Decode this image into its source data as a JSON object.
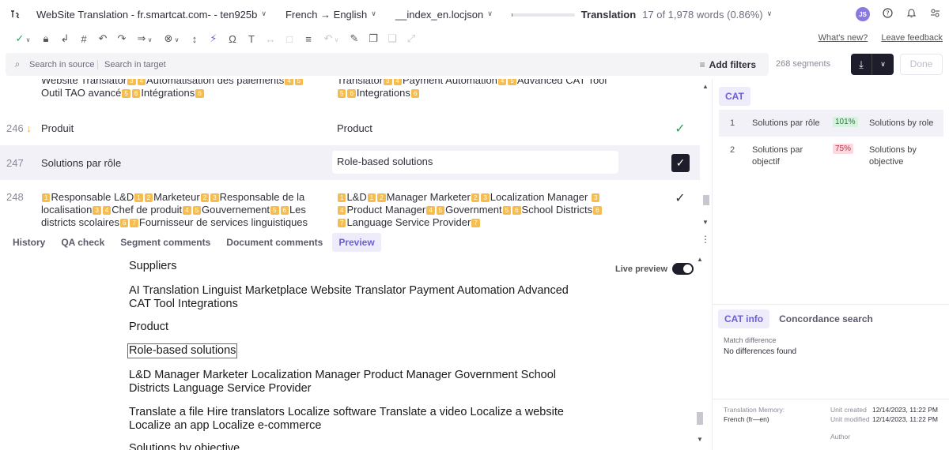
{
  "topbar": {
    "project": "WebSite Translation - fr.smartcat.com- - ten925b",
    "languages": "French → English",
    "file": "__index_en.locjson",
    "stage": "Translation",
    "progress_words": "17 of 1,978 words (0.86%)",
    "progress_fraction": 0.0086,
    "user_initials": "JS"
  },
  "toolbar": {
    "whats_new": "What's new?",
    "leave_feedback": "Leave feedback"
  },
  "search": {
    "source_placeholder": "Search in source",
    "target_placeholder": "Search in target",
    "add_filters": "Add filters",
    "segment_count": "268 segments",
    "done_label": "Done"
  },
  "segments": [
    {
      "num": "",
      "src": [
        {
          "t": "Website Translator"
        },
        {
          "g": "3"
        },
        {
          "g": "4"
        },
        {
          "t": "Automatisation des paiements"
        },
        {
          "g": "4"
        },
        {
          "g": "5"
        },
        {
          "t": " Outil TAO avancé"
        },
        {
          "g": "5"
        },
        {
          "g": "6"
        },
        {
          "t": "Intégrations"
        },
        {
          "g": "6"
        }
      ],
      "tgt": [
        {
          "t": "Translator"
        },
        {
          "g": "3"
        },
        {
          "g": "4"
        },
        {
          "t": "Payment Automation"
        },
        {
          "g": "4"
        },
        {
          "g": "5"
        },
        {
          "t": "Advanced CAT Tool"
        },
        {
          "g": "5"
        },
        {
          "g": "6"
        },
        {
          "t": "Integrations"
        },
        {
          "g": "6"
        }
      ]
    },
    {
      "num": "246",
      "src_text": "Produit",
      "tgt_text": "Product"
    },
    {
      "num": "247",
      "src_text": "Solutions par rôle",
      "tgt_text": "Role-based solutions"
    },
    {
      "num": "248",
      "src": [
        {
          "g": "1"
        },
        {
          "t": "Responsable L&D"
        },
        {
          "g": "1"
        },
        {
          "g": "2"
        },
        {
          "t": "Marketeur"
        },
        {
          "g": "2"
        },
        {
          "g": "3"
        },
        {
          "t": "Responsable de la localisation"
        },
        {
          "g": "3"
        },
        {
          "g": "4"
        },
        {
          "t": "Chef de produit"
        },
        {
          "g": "4"
        },
        {
          "g": "5"
        },
        {
          "t": "Gouvernement"
        },
        {
          "g": "5"
        },
        {
          "g": "6"
        },
        {
          "t": "Les districts scolaires"
        },
        {
          "g": "6"
        },
        {
          "g": "7"
        },
        {
          "t": "Fournisseur de services linguistiques"
        }
      ],
      "tgt": [
        {
          "g": "1"
        },
        {
          "t": "L&D"
        },
        {
          "g": "1"
        },
        {
          "g": "2"
        },
        {
          "t": "Manager Marketer"
        },
        {
          "g": "2"
        },
        {
          "g": "3"
        },
        {
          "t": "Localization Manager "
        },
        {
          "g": "3"
        },
        {
          "g": "4"
        },
        {
          "t": "Product Manager"
        },
        {
          "g": "4"
        },
        {
          "g": "5"
        },
        {
          "t": "Government"
        },
        {
          "g": "5"
        },
        {
          "g": "6"
        },
        {
          "t": "School Districts"
        },
        {
          "g": "6"
        },
        {
          "g": "7"
        },
        {
          "t": "Language Service Provider"
        },
        {
          "g": "7"
        }
      ]
    }
  ],
  "bottom_tabs": [
    "History",
    "QA check",
    "Segment comments",
    "Document comments",
    "Preview"
  ],
  "preview": {
    "live_preview_label": "Live preview",
    "lines": [
      "Suppliers",
      "AI Translation Linguist Marketplace Website Translator Payment Automation Advanced CAT Tool Integrations",
      "Product",
      "Role-based solutions",
      "L&D Manager Marketer Localization Manager Product Manager Government School Districts Language Service Provider",
      "Translate a file Hire translators Localize software Translate a video Localize a website Localize an app Localize e-commerce",
      "Solutions by objective"
    ]
  },
  "cat": {
    "tab": "CAT",
    "matches": [
      {
        "index": "1",
        "source": "Solutions par rôle",
        "percent": "101%",
        "target": "Solutions by role"
      },
      {
        "index": "2",
        "source": "Solutions par objectif",
        "percent": "75%",
        "target": "Solutions by objective"
      }
    ]
  },
  "catinfo": {
    "tabs": [
      "CAT info",
      "Concordance search"
    ],
    "match_diff_label": "Match difference",
    "match_diff_value": "No differences found",
    "tm_label": "Translation Memory:",
    "tm_value": "French  (fr—en)",
    "unit_created_label": "Unit created",
    "unit_created_value": "12/14/2023, 11:22 PM",
    "unit_modified_label": "Unit modified",
    "unit_modified_value": "12/14/2023, 11:22 PM",
    "author_label": "Author"
  },
  "colors": {
    "accent": "#6b5fd6",
    "tag": "#f5bd4f",
    "dark": "#1e1d2b",
    "check_green": "#2e9f5b"
  }
}
